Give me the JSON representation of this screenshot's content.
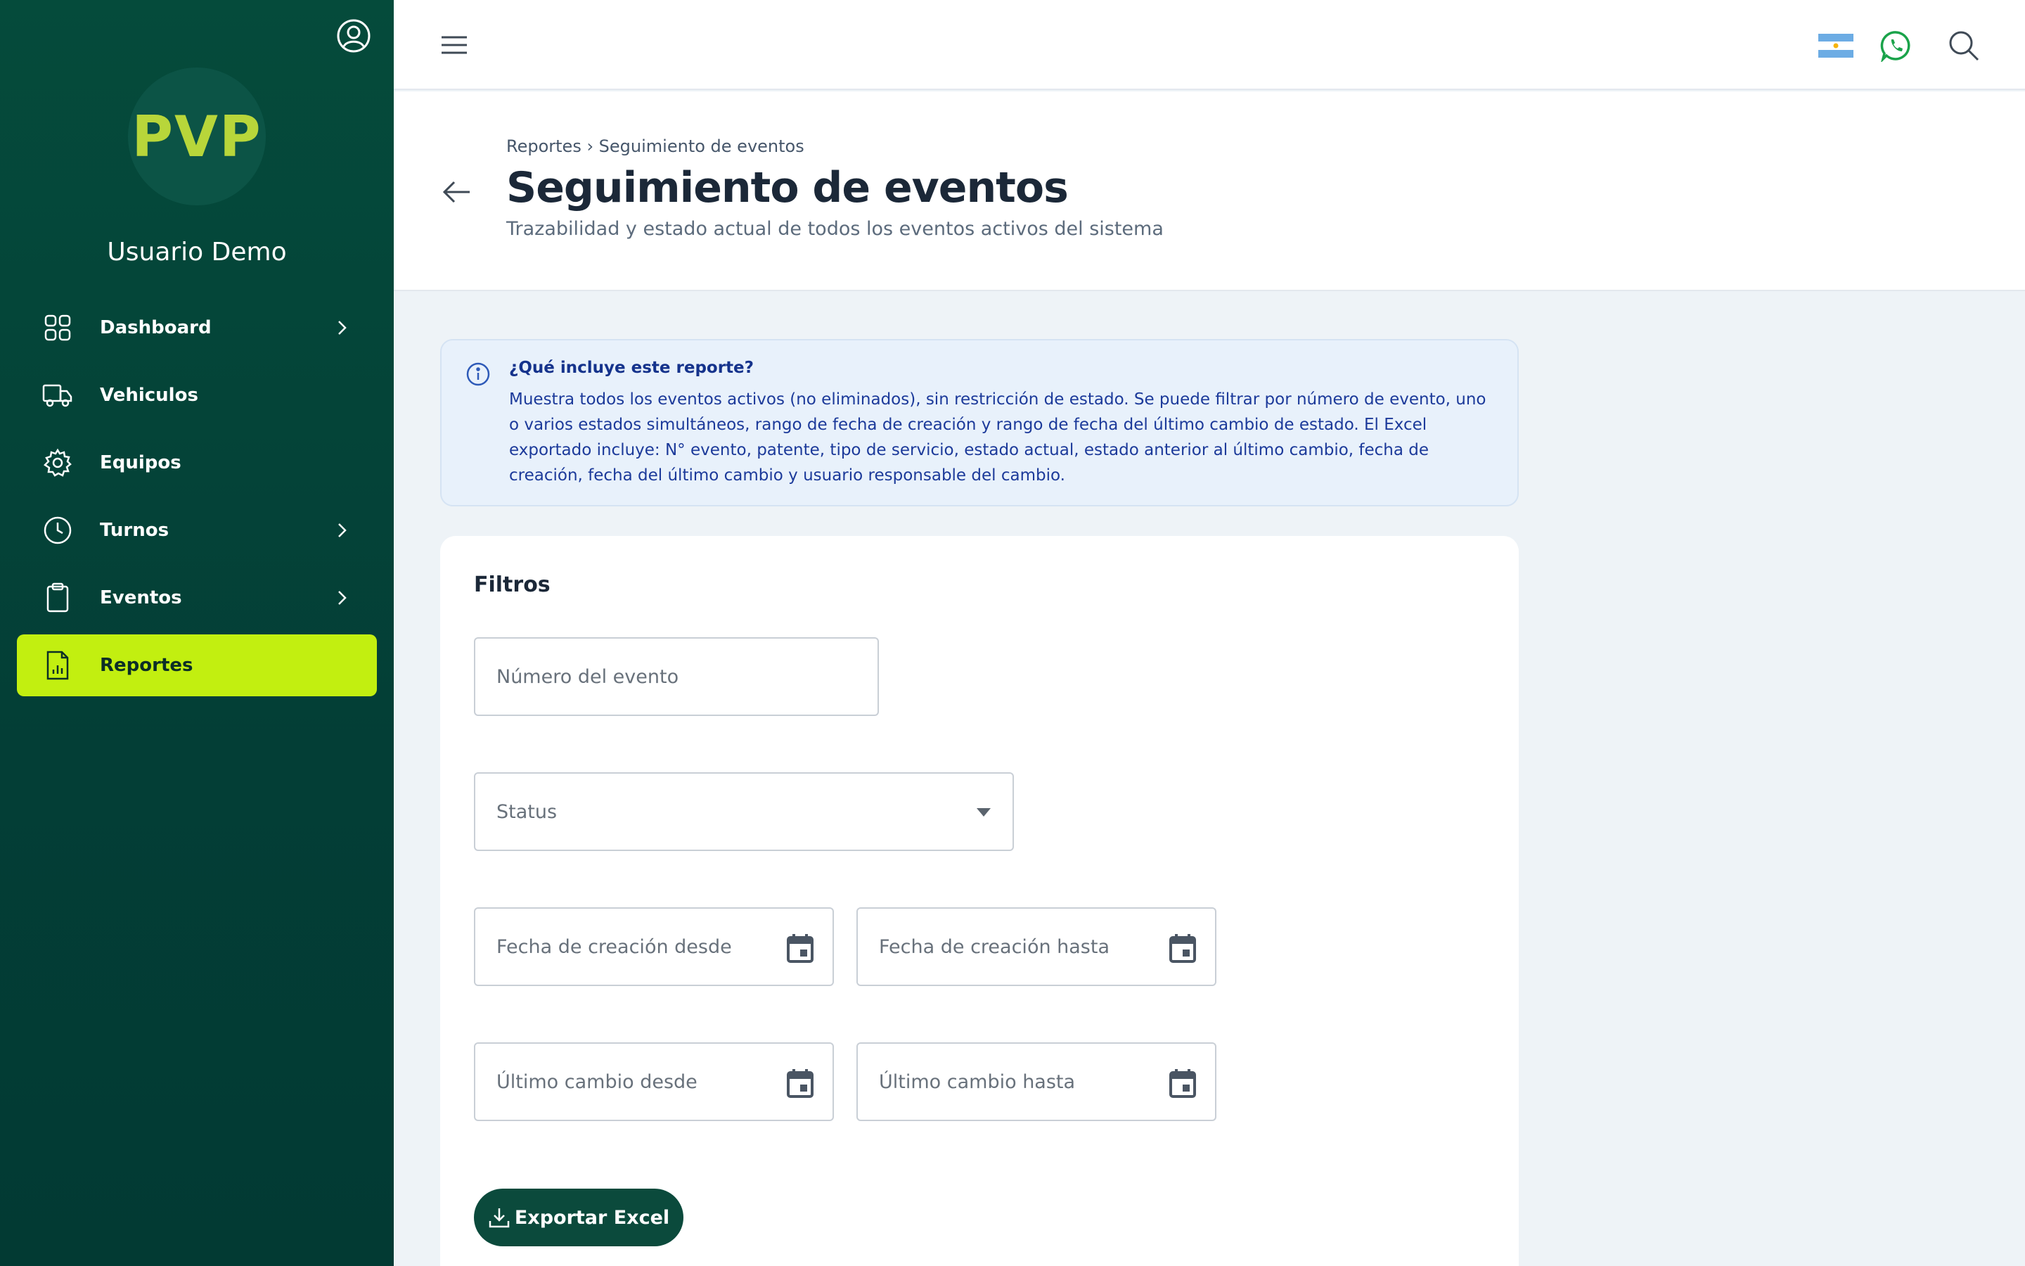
{
  "sidebar": {
    "logo_text": "PVP",
    "username": "Usuario Demo",
    "items": [
      {
        "label": "Dashboard",
        "icon": "grid-icon",
        "has_chevron": true
      },
      {
        "label": "Vehiculos",
        "icon": "truck-icon",
        "has_chevron": false
      },
      {
        "label": "Equipos",
        "icon": "gear-icon",
        "has_chevron": false
      },
      {
        "label": "Turnos",
        "icon": "clock-icon",
        "has_chevron": true
      },
      {
        "label": "Eventos",
        "icon": "clipboard-icon",
        "has_chevron": true
      },
      {
        "label": "Reportes",
        "icon": "report-icon",
        "has_chevron": false,
        "active": true
      }
    ]
  },
  "header": {
    "breadcrumb": "Reportes › Seguimiento de eventos",
    "title": "Seguimiento de eventos",
    "subtitle": "Trazabilidad y estado actual de todos los eventos activos del sistema"
  },
  "info": {
    "title": "¿Qué incluye este reporte?",
    "body": "Muestra todos los eventos activos (no eliminados), sin restricción de estado. Se puede filtrar por número de evento, uno o varios estados simultáneos, rango de fecha de creación y rango de fecha del último cambio de estado. El Excel exportado incluye: N° evento, patente, tipo de servicio, estado actual, estado anterior al último cambio, fecha de creación, fecha del último cambio y usuario responsable del cambio."
  },
  "filters": {
    "title": "Filtros",
    "event_number_placeholder": "Número del evento",
    "status_placeholder": "Status",
    "created_from": "Fecha de creación desde",
    "created_to": "Fecha de creación hasta",
    "changed_from": "Último cambio desde",
    "changed_to": "Último cambio hasta",
    "export_label": "Exportar Excel"
  },
  "colors": {
    "sidebar_bg": "#054b3b",
    "accent": "#c2ef10",
    "primary_button": "#0b4a3c",
    "info_bg": "#e8f1fb"
  }
}
